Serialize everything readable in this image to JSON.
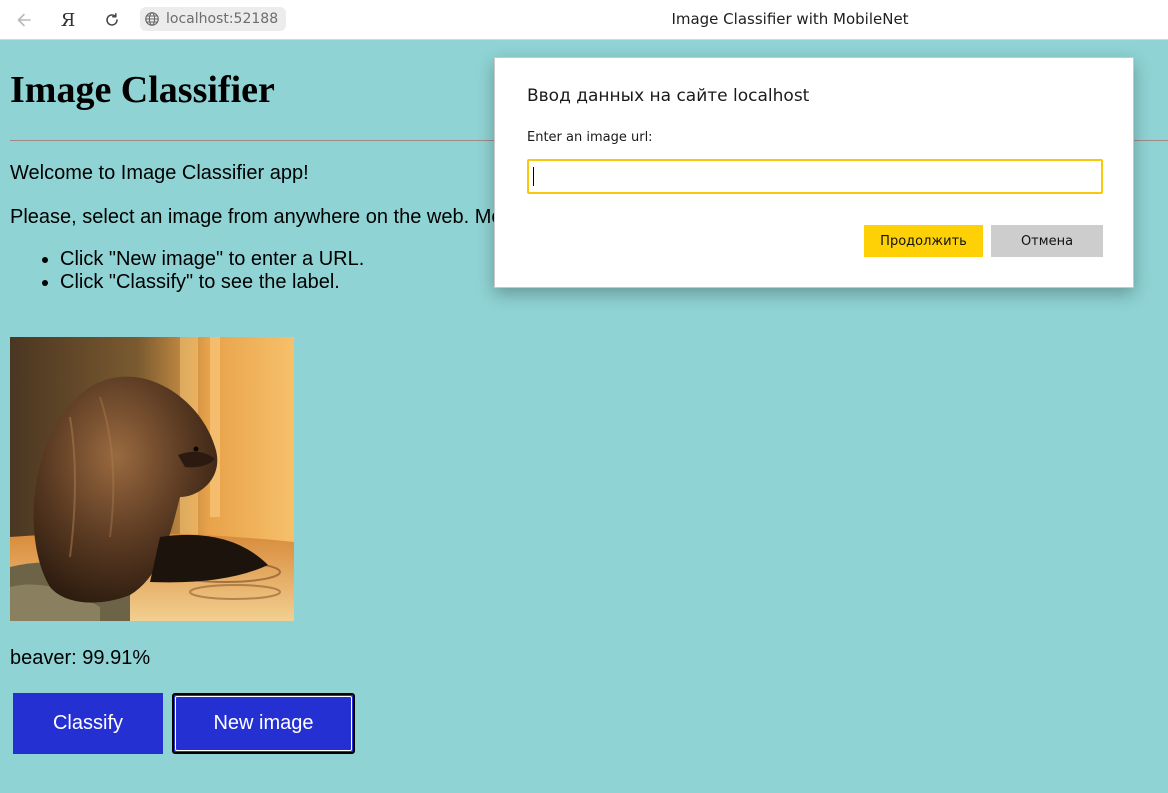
{
  "browser": {
    "logo_glyph": "Я",
    "address": "localhost:52188",
    "tab_title": "Image Classifier with MobileNet",
    "icons": [
      "back-arrow-icon",
      "yandex-logo-icon",
      "reload-icon",
      "globe-icon"
    ]
  },
  "page": {
    "heading": "Image Classifier",
    "welcome": "Welcome to Image Classifier app!",
    "instructions": "Please, select an image from anywhere on the web. Mo",
    "steps": [
      "Click \"New image\" to enter a URL.",
      "Click \"Classify\" to see the label."
    ],
    "image_alt": "beaver",
    "result": "beaver: 99.91%",
    "buttons": {
      "classify": "Classify",
      "new_image": "New image"
    },
    "colors": {
      "background": "#8fd3d4",
      "button": "#2430d1",
      "button_text": "#ffffff"
    }
  },
  "dialog": {
    "title": "Ввод данных на сайте localhost",
    "label": "Enter an image url:",
    "input_value": "",
    "continue_label": "Продолжить",
    "cancel_label": "Отмена",
    "colors": {
      "focus_border": "#f7c90a",
      "continue_bg": "#fdd106",
      "cancel_bg": "#cdcdcd"
    }
  }
}
